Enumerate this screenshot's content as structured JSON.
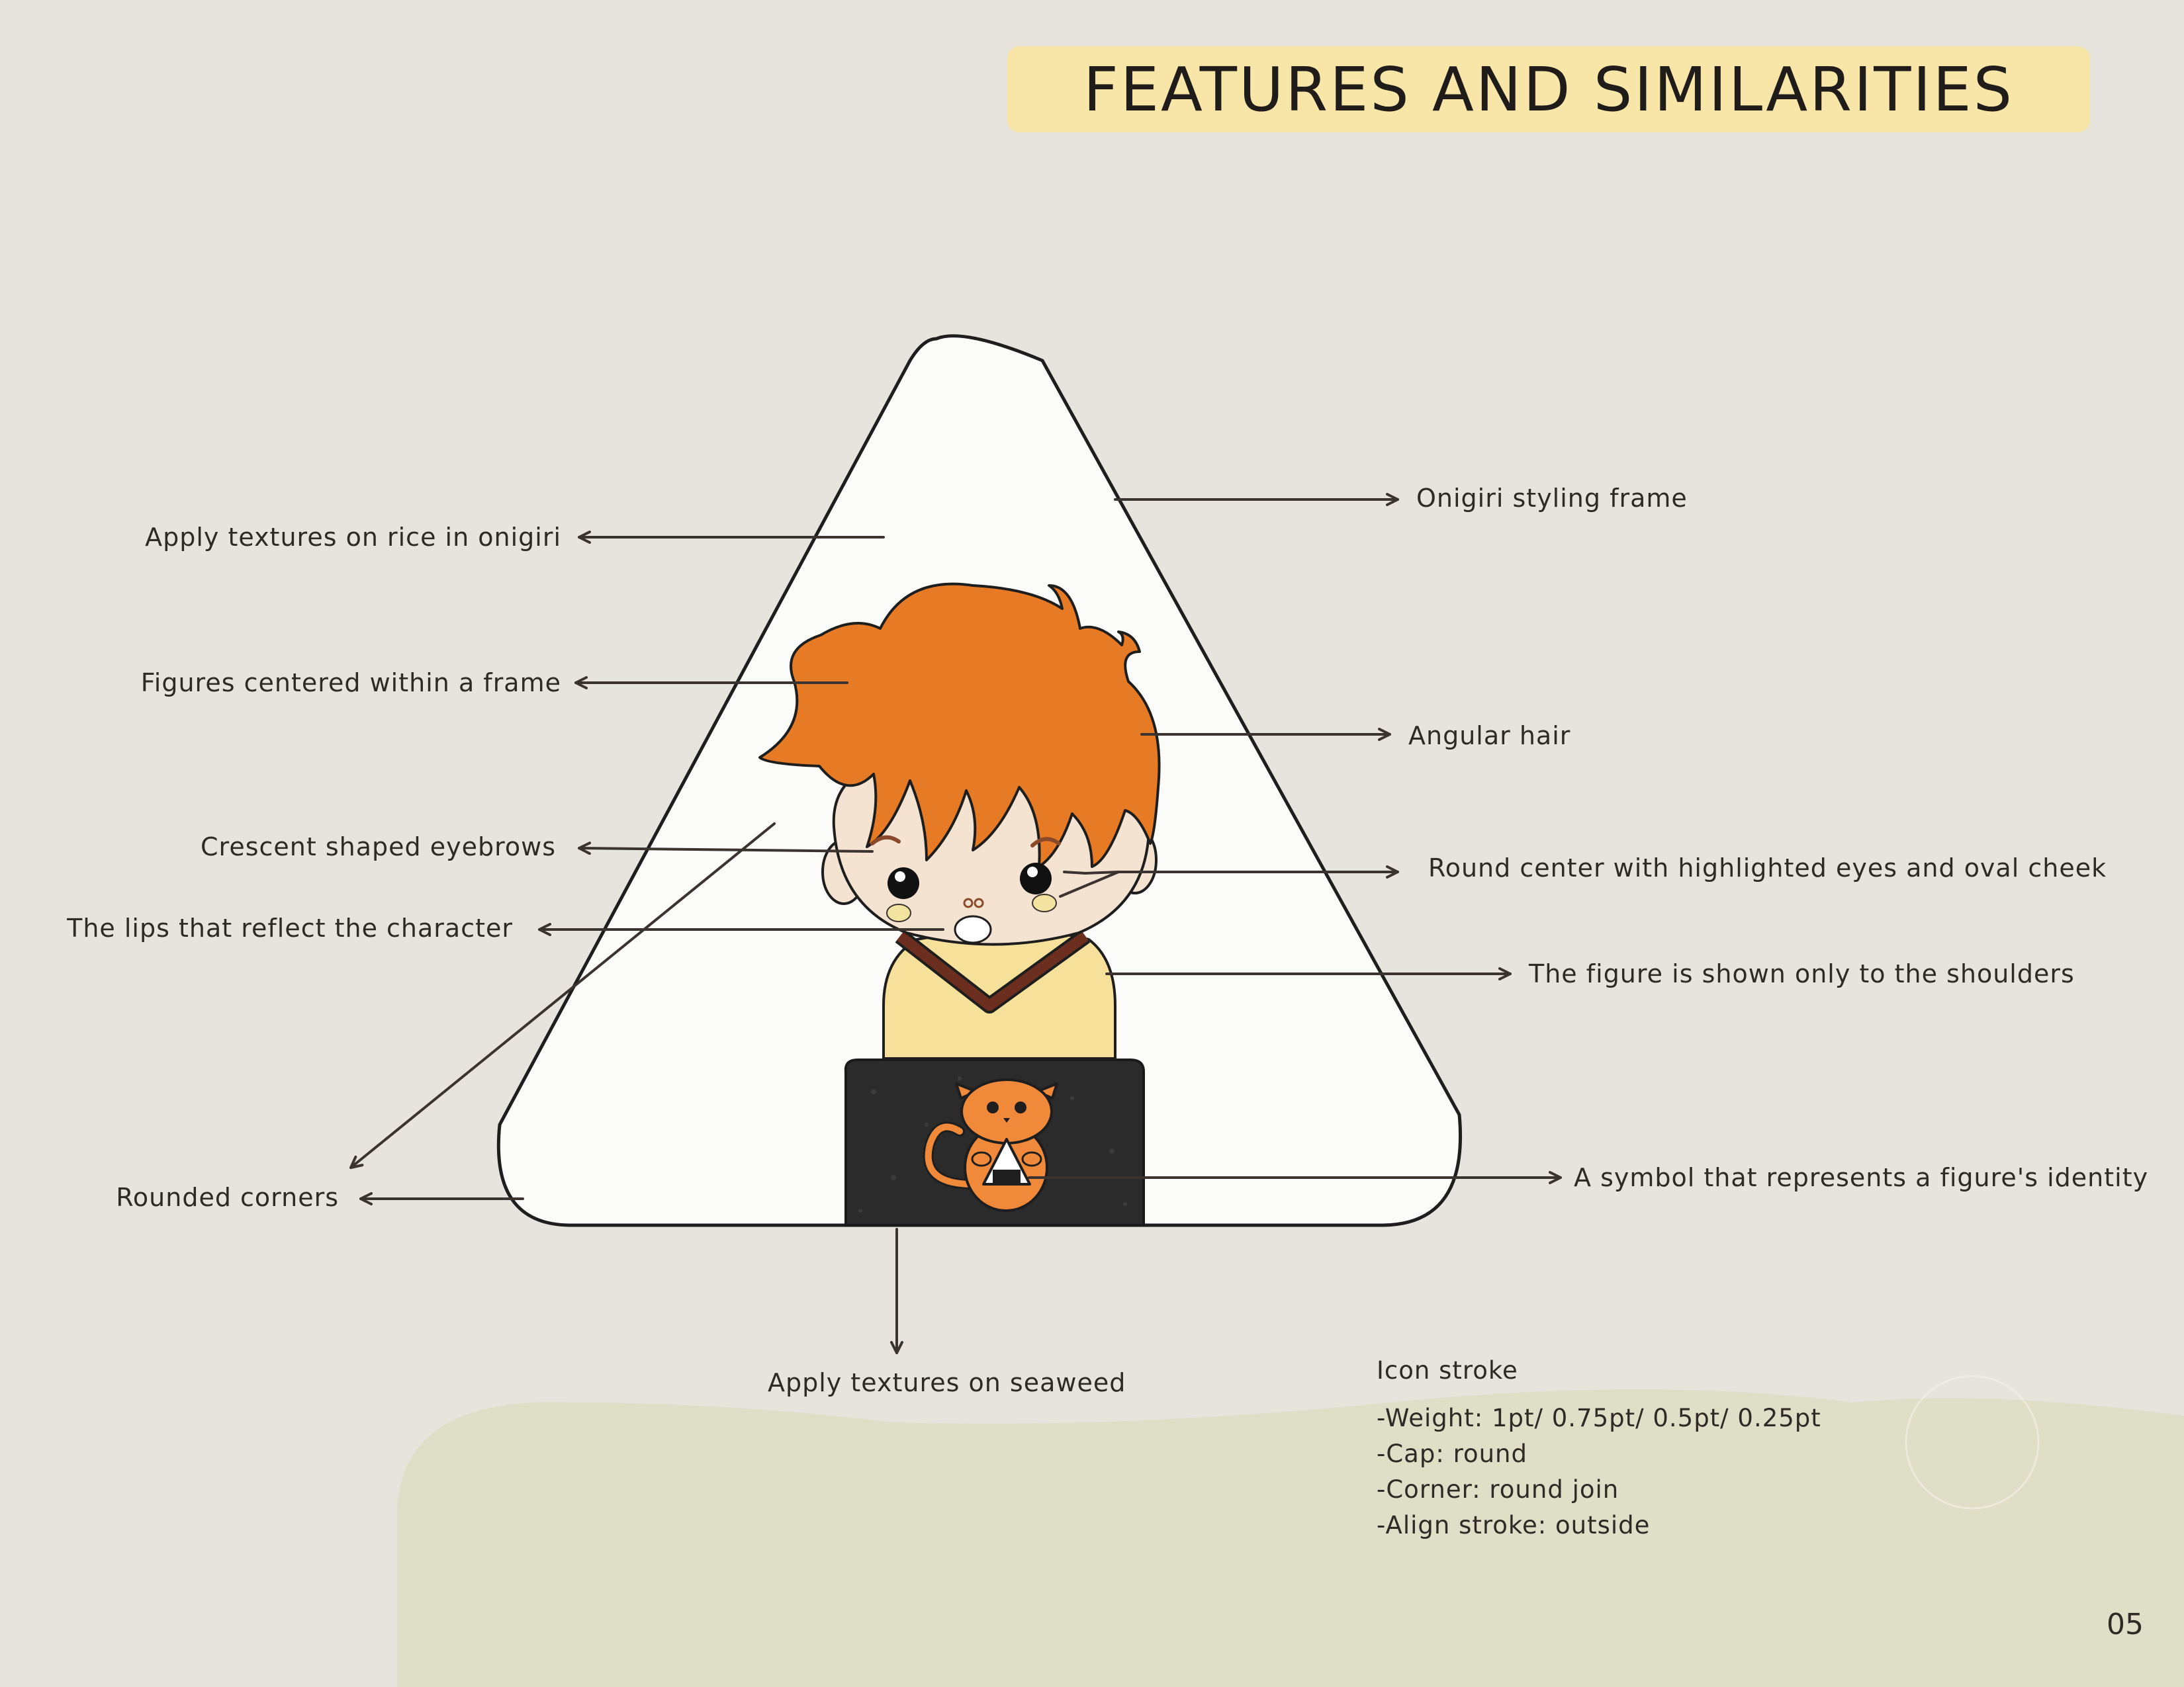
{
  "page": {
    "title": "FEATURES AND SIMILARITIES",
    "page_number": "05"
  },
  "annotations": {
    "left": {
      "rice_texture": "Apply textures on rice in onigiri",
      "centered_figure": "Figures centered within a frame",
      "eyebrows": "Crescent shaped eyebrows",
      "lips": "The lips that reflect the character",
      "rounded_corners": "Rounded corners"
    },
    "right": {
      "frame": "Onigiri styling frame",
      "hair": "Angular hair",
      "center": "Round center with highlighted eyes and oval cheek",
      "shoulders": "The figure is shown only to the shoulders",
      "symbol": "A symbol that represents a figure's identity"
    },
    "bottom": {
      "seaweed": "Apply textures on seaweed"
    }
  },
  "icon_stroke": {
    "heading": "Icon stroke",
    "lines": [
      "-Weight: 1pt/ 0.75pt/ 0.5pt/ 0.25pt",
      "-Cap: round",
      "-Corner: round join",
      "-Align stroke: outside"
    ]
  },
  "colors": {
    "background": "#e6e4dc",
    "title_band": "#f7e6a8",
    "hair": "#e77a25",
    "skin": "#f5e3d2",
    "shirt": "#f6e09a",
    "collar": "#6b2e1f",
    "seaweed": "#2b2b2b",
    "cat": "#f08a3a",
    "blob": "#dcdcc0"
  }
}
